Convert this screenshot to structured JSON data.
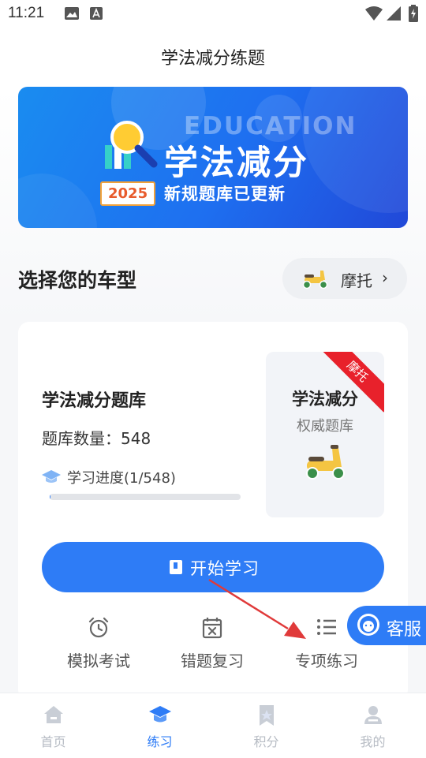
{
  "status_bar": {
    "time": "11:21"
  },
  "header": {
    "title": "学法减分练题"
  },
  "banner": {
    "english": "EDUCATION",
    "title": "学法减分",
    "year": "2025",
    "subtitle": "新规题库已更新"
  },
  "vehicle_section": {
    "title": "选择您的车型",
    "selected_vehicle": "摩托",
    "chevron": "›"
  },
  "card": {
    "bank_title": "学法减分题库",
    "bank_count": "题库数量：548",
    "progress_label": "学习进度(1/548)",
    "progress_fraction": 0.0018,
    "promo_title": "学法减分",
    "promo_subtitle": "权威题库",
    "ribbon": "摩托",
    "start_button": "开始学习",
    "actions": [
      {
        "label": "模拟考试",
        "icon": "alarm-clock-icon"
      },
      {
        "label": "错题复习",
        "icon": "calendar-x-icon"
      },
      {
        "label": "专项练习",
        "icon": "list-icon"
      }
    ]
  },
  "customer_service": {
    "label": "客服"
  },
  "tabbar": {
    "tabs": [
      {
        "label": "首页",
        "icon": "home-icon",
        "active": false
      },
      {
        "label": "练习",
        "icon": "graduation-cap-icon",
        "active": true
      },
      {
        "label": "积分",
        "icon": "bookmark-star-icon",
        "active": false
      },
      {
        "label": "我的",
        "icon": "user-icon",
        "active": false
      }
    ]
  },
  "colors": {
    "primary": "#2e7cf6",
    "ribbon": "#e8212b",
    "arrow": "#e03a3a",
    "inactive_tab": "#b7bcc4"
  }
}
